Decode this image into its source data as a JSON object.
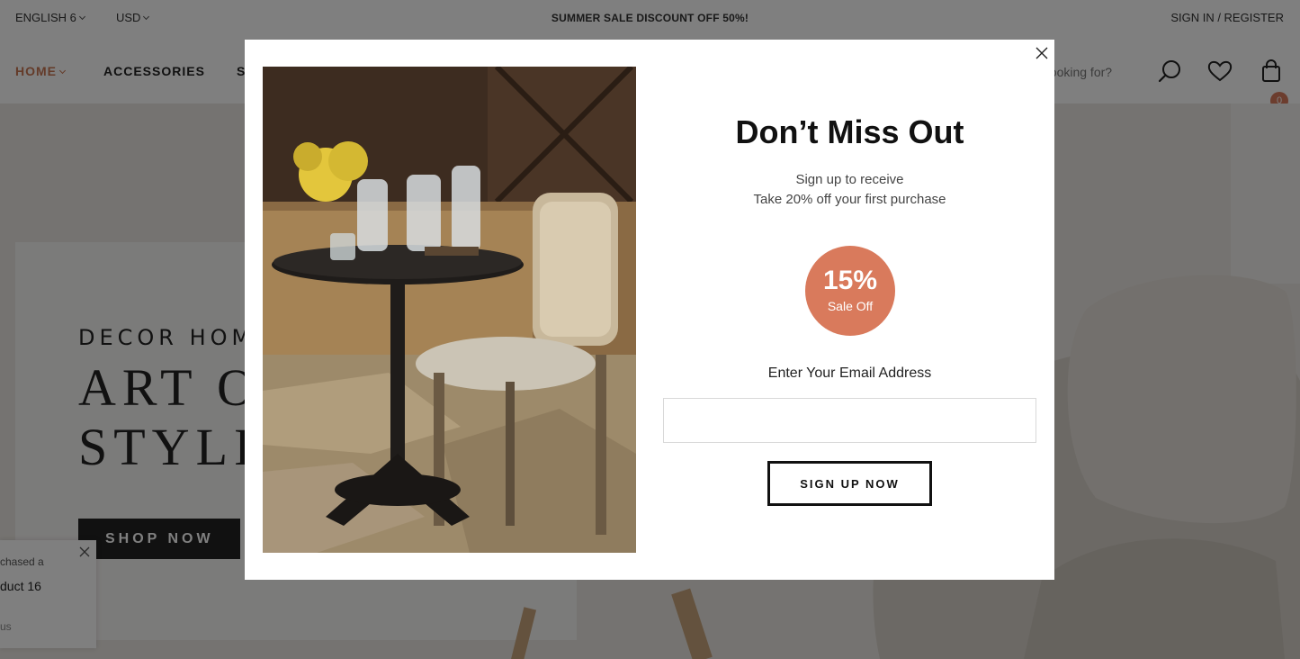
{
  "topbar": {
    "language": "ENGLISH 6",
    "currency": "USD",
    "promo": "SUMMER SALE DISCOUNT OFF 50%!",
    "auth": "SIGN IN / REGISTER"
  },
  "nav": {
    "items": [
      {
        "label": "HOME"
      },
      {
        "label": "ACCESSORIES"
      },
      {
        "label": "S"
      }
    ],
    "search_placeholder": "u looking for?",
    "cart_count": "0"
  },
  "hero": {
    "eyebrow": "DECOR HOM",
    "title_line1": "ART O",
    "title_line2": "STYLIS",
    "cta": "SHOP NOW"
  },
  "toast": {
    "line1": "chased a",
    "line2": "duct 16",
    "line3": "us"
  },
  "modal": {
    "title": "Don’t Miss Out",
    "subtitle_line1": "Sign up to receive",
    "subtitle_line2": "Take 20% off your first purchase",
    "badge_percent": "15%",
    "badge_label": "Sale Off",
    "email_label": "Enter Your Email Address",
    "email_value": "",
    "email_placeholder": "",
    "submit_label": "SIGN UP NOW"
  },
  "colors": {
    "accent": "#d97a5c",
    "overlay": "rgba(0,0,0,0.5)",
    "dark": "#222222"
  },
  "icons": [
    "chevron-down-icon",
    "search-icon",
    "heart-icon",
    "cart-icon",
    "close-icon"
  ]
}
